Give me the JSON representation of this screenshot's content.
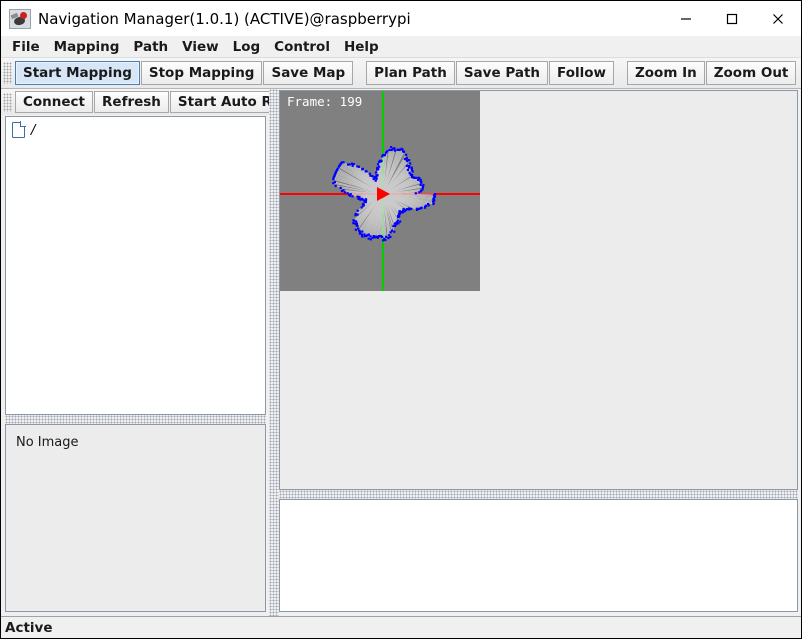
{
  "window": {
    "title": "Navigation Manager(1.0.1) (ACTIVE)@raspberrypi",
    "app_icon": "robot-bird-icon",
    "controls": {
      "minimize": "minimize-icon",
      "maximize": "maximize-icon",
      "close": "close-icon"
    }
  },
  "menubar": {
    "items": [
      {
        "label": "File"
      },
      {
        "label": "Mapping"
      },
      {
        "label": "Path"
      },
      {
        "label": "View"
      },
      {
        "label": "Log"
      },
      {
        "label": "Control"
      },
      {
        "label": "Help"
      }
    ]
  },
  "toolbar": {
    "groups": [
      {
        "buttons": [
          {
            "label": "Start Mapping",
            "focused": true
          },
          {
            "label": "Stop Mapping",
            "focused": false
          },
          {
            "label": "Save Map",
            "focused": false
          }
        ]
      },
      {
        "buttons": [
          {
            "label": "Plan Path",
            "focused": false
          },
          {
            "label": "Save Path",
            "focused": false
          },
          {
            "label": "Follow",
            "focused": false
          }
        ]
      },
      {
        "buttons": [
          {
            "label": "Zoom In",
            "focused": false
          },
          {
            "label": "Zoom Out",
            "focused": false
          }
        ]
      }
    ]
  },
  "left_panel": {
    "toolbar": {
      "buttons": [
        {
          "label": "Connect"
        },
        {
          "label": "Refresh"
        },
        {
          "label": "Start Auto Refr"
        }
      ]
    },
    "tree": {
      "items": [
        {
          "label": "/",
          "icon": "document-icon"
        }
      ]
    },
    "image_panel": {
      "placeholder": "No Image"
    }
  },
  "map_view": {
    "frame_label": "Frame: 199",
    "colors": {
      "map_background": "#808080",
      "panel_background": "#ececec",
      "x_axis": "#ff0000",
      "y_axis": "#00d000",
      "robot": "#ff0000",
      "scan_points": "#0000ff",
      "ray_trace": "#d8d8d8"
    },
    "robot_heading_deg": 0
  },
  "log_panel": {
    "content": ""
  },
  "statusbar": {
    "text": "Active"
  }
}
